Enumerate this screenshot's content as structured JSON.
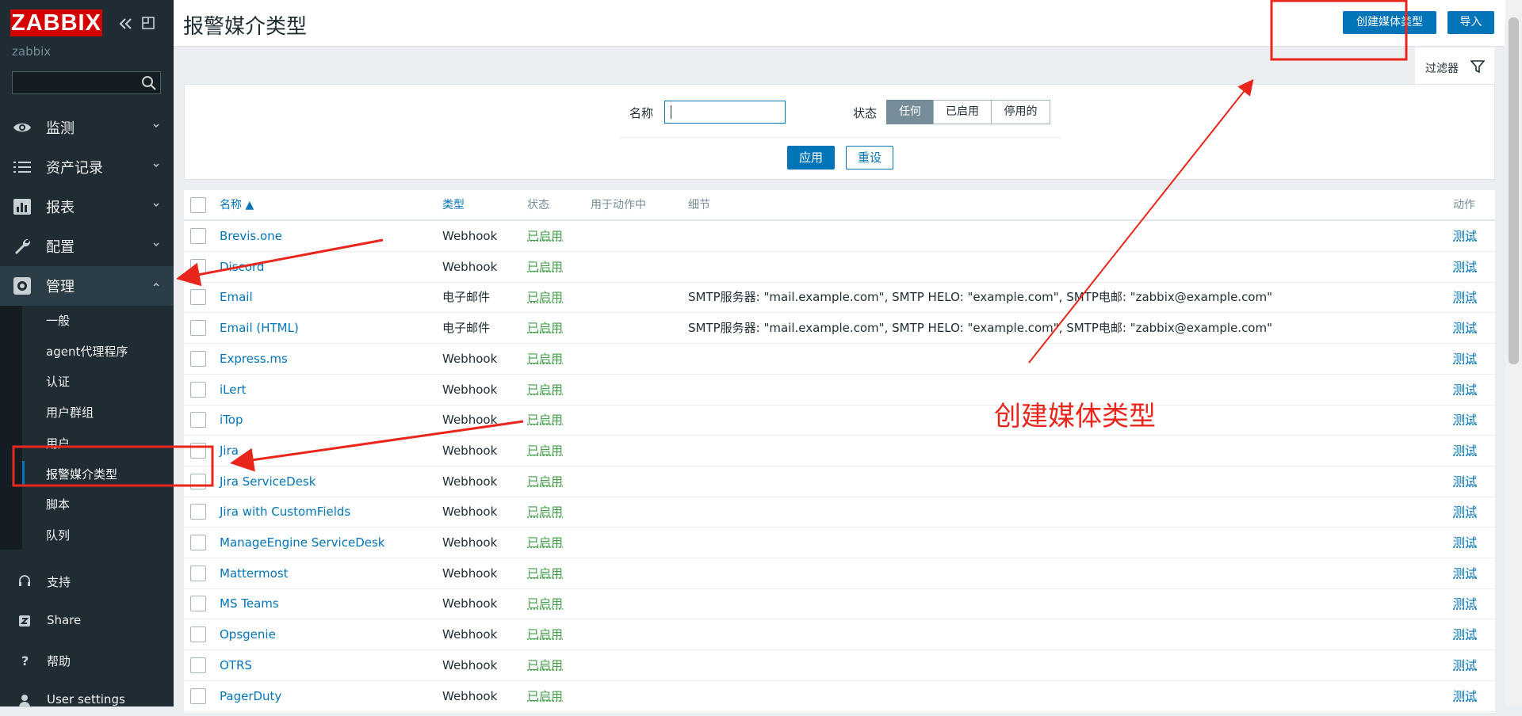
{
  "sidebar": {
    "logo": "ZABBIX",
    "server_name": "zabbix",
    "search_placeholder": "",
    "menu": [
      {
        "label": "监测",
        "icon": "eye-icon"
      },
      {
        "label": "资产记录",
        "icon": "list-icon"
      },
      {
        "label": "报表",
        "icon": "bar-chart-icon"
      },
      {
        "label": "配置",
        "icon": "wrench-icon"
      },
      {
        "label": "管理",
        "icon": "gear-icon"
      }
    ],
    "submenu": [
      "一般",
      "agent代理程序",
      "认证",
      "用户群组",
      "用户",
      "报警媒介类型",
      "脚本",
      "队列"
    ],
    "bottom": [
      {
        "label": "支持",
        "icon": "headset-icon"
      },
      {
        "label": "Share",
        "icon": "share-icon"
      },
      {
        "label": "帮助",
        "icon": "help-icon"
      },
      {
        "label": "User settings",
        "icon": "user-icon"
      }
    ]
  },
  "header": {
    "title": "报警媒介类型",
    "create_button": "创建媒体类型",
    "import_button": "导入"
  },
  "filter": {
    "tab_label": "过滤器",
    "name_label": "名称",
    "name_value": "",
    "status_label": "状态",
    "status_options": [
      "任何",
      "已启用",
      "停用的"
    ],
    "status_selected": "任何",
    "apply": "应用",
    "reset": "重设"
  },
  "table": {
    "columns": {
      "name": "名称 ▲",
      "type": "类型",
      "status": "状态",
      "used": "用于动作中",
      "details": "细节",
      "action": "动作"
    },
    "rows": [
      {
        "name": "Brevis.one",
        "type": "Webhook",
        "status": "已启用",
        "details": "",
        "action": "测试"
      },
      {
        "name": "Discord",
        "type": "Webhook",
        "status": "已启用",
        "details": "",
        "action": "测试"
      },
      {
        "name": "Email",
        "type": "电子邮件",
        "status": "已启用",
        "details": "SMTP服务器: \"mail.example.com\", SMTP HELO: \"example.com\", SMTP电邮: \"zabbix@example.com\"",
        "action": "测试"
      },
      {
        "name": "Email (HTML)",
        "type": "电子邮件",
        "status": "已启用",
        "details": "SMTP服务器: \"mail.example.com\", SMTP HELO: \"example.com\", SMTP电邮: \"zabbix@example.com\"",
        "action": "测试"
      },
      {
        "name": "Express.ms",
        "type": "Webhook",
        "status": "已启用",
        "details": "",
        "action": "测试"
      },
      {
        "name": "iLert",
        "type": "Webhook",
        "status": "已启用",
        "details": "",
        "action": "测试"
      },
      {
        "name": "iTop",
        "type": "Webhook",
        "status": "已启用",
        "details": "",
        "action": "测试"
      },
      {
        "name": "Jira",
        "type": "Webhook",
        "status": "已启用",
        "details": "",
        "action": "测试"
      },
      {
        "name": "Jira ServiceDesk",
        "type": "Webhook",
        "status": "已启用",
        "details": "",
        "action": "测试"
      },
      {
        "name": "Jira with CustomFields",
        "type": "Webhook",
        "status": "已启用",
        "details": "",
        "action": "测试"
      },
      {
        "name": "ManageEngine ServiceDesk",
        "type": "Webhook",
        "status": "已启用",
        "details": "",
        "action": "测试"
      },
      {
        "name": "Mattermost",
        "type": "Webhook",
        "status": "已启用",
        "details": "",
        "action": "测试"
      },
      {
        "name": "MS Teams",
        "type": "Webhook",
        "status": "已启用",
        "details": "",
        "action": "测试"
      },
      {
        "name": "Opsgenie",
        "type": "Webhook",
        "status": "已启用",
        "details": "",
        "action": "测试"
      },
      {
        "name": "OTRS",
        "type": "Webhook",
        "status": "已启用",
        "details": "",
        "action": "测试"
      },
      {
        "name": "PagerDuty",
        "type": "Webhook",
        "status": "已启用",
        "details": "",
        "action": "测试"
      }
    ]
  },
  "annotation": {
    "text": "创建媒体类型",
    "color": "#e8261c"
  },
  "colors": {
    "sidebar_bg": "#1f2c33",
    "accent": "#0275b8",
    "status_enabled": "#429e47",
    "logo_red": "#d40000"
  }
}
